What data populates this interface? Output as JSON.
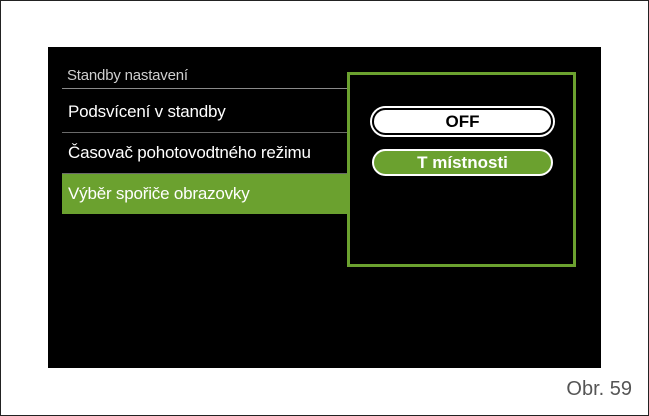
{
  "menu": {
    "title": "Standby nastavení",
    "items": [
      {
        "label": "Podsvícení v standby",
        "selected": false
      },
      {
        "label": "Časovač pohotovodtného režimu",
        "selected": false
      },
      {
        "label": "Výběr spořiče obrazovky",
        "selected": true
      }
    ]
  },
  "popup": {
    "options": [
      {
        "label": "OFF",
        "selected": false
      },
      {
        "label": "T místnosti",
        "selected": true
      }
    ]
  },
  "caption": "Obr. 59",
  "colors": {
    "accent": "#6ba12f",
    "screen_background": "#000000"
  }
}
